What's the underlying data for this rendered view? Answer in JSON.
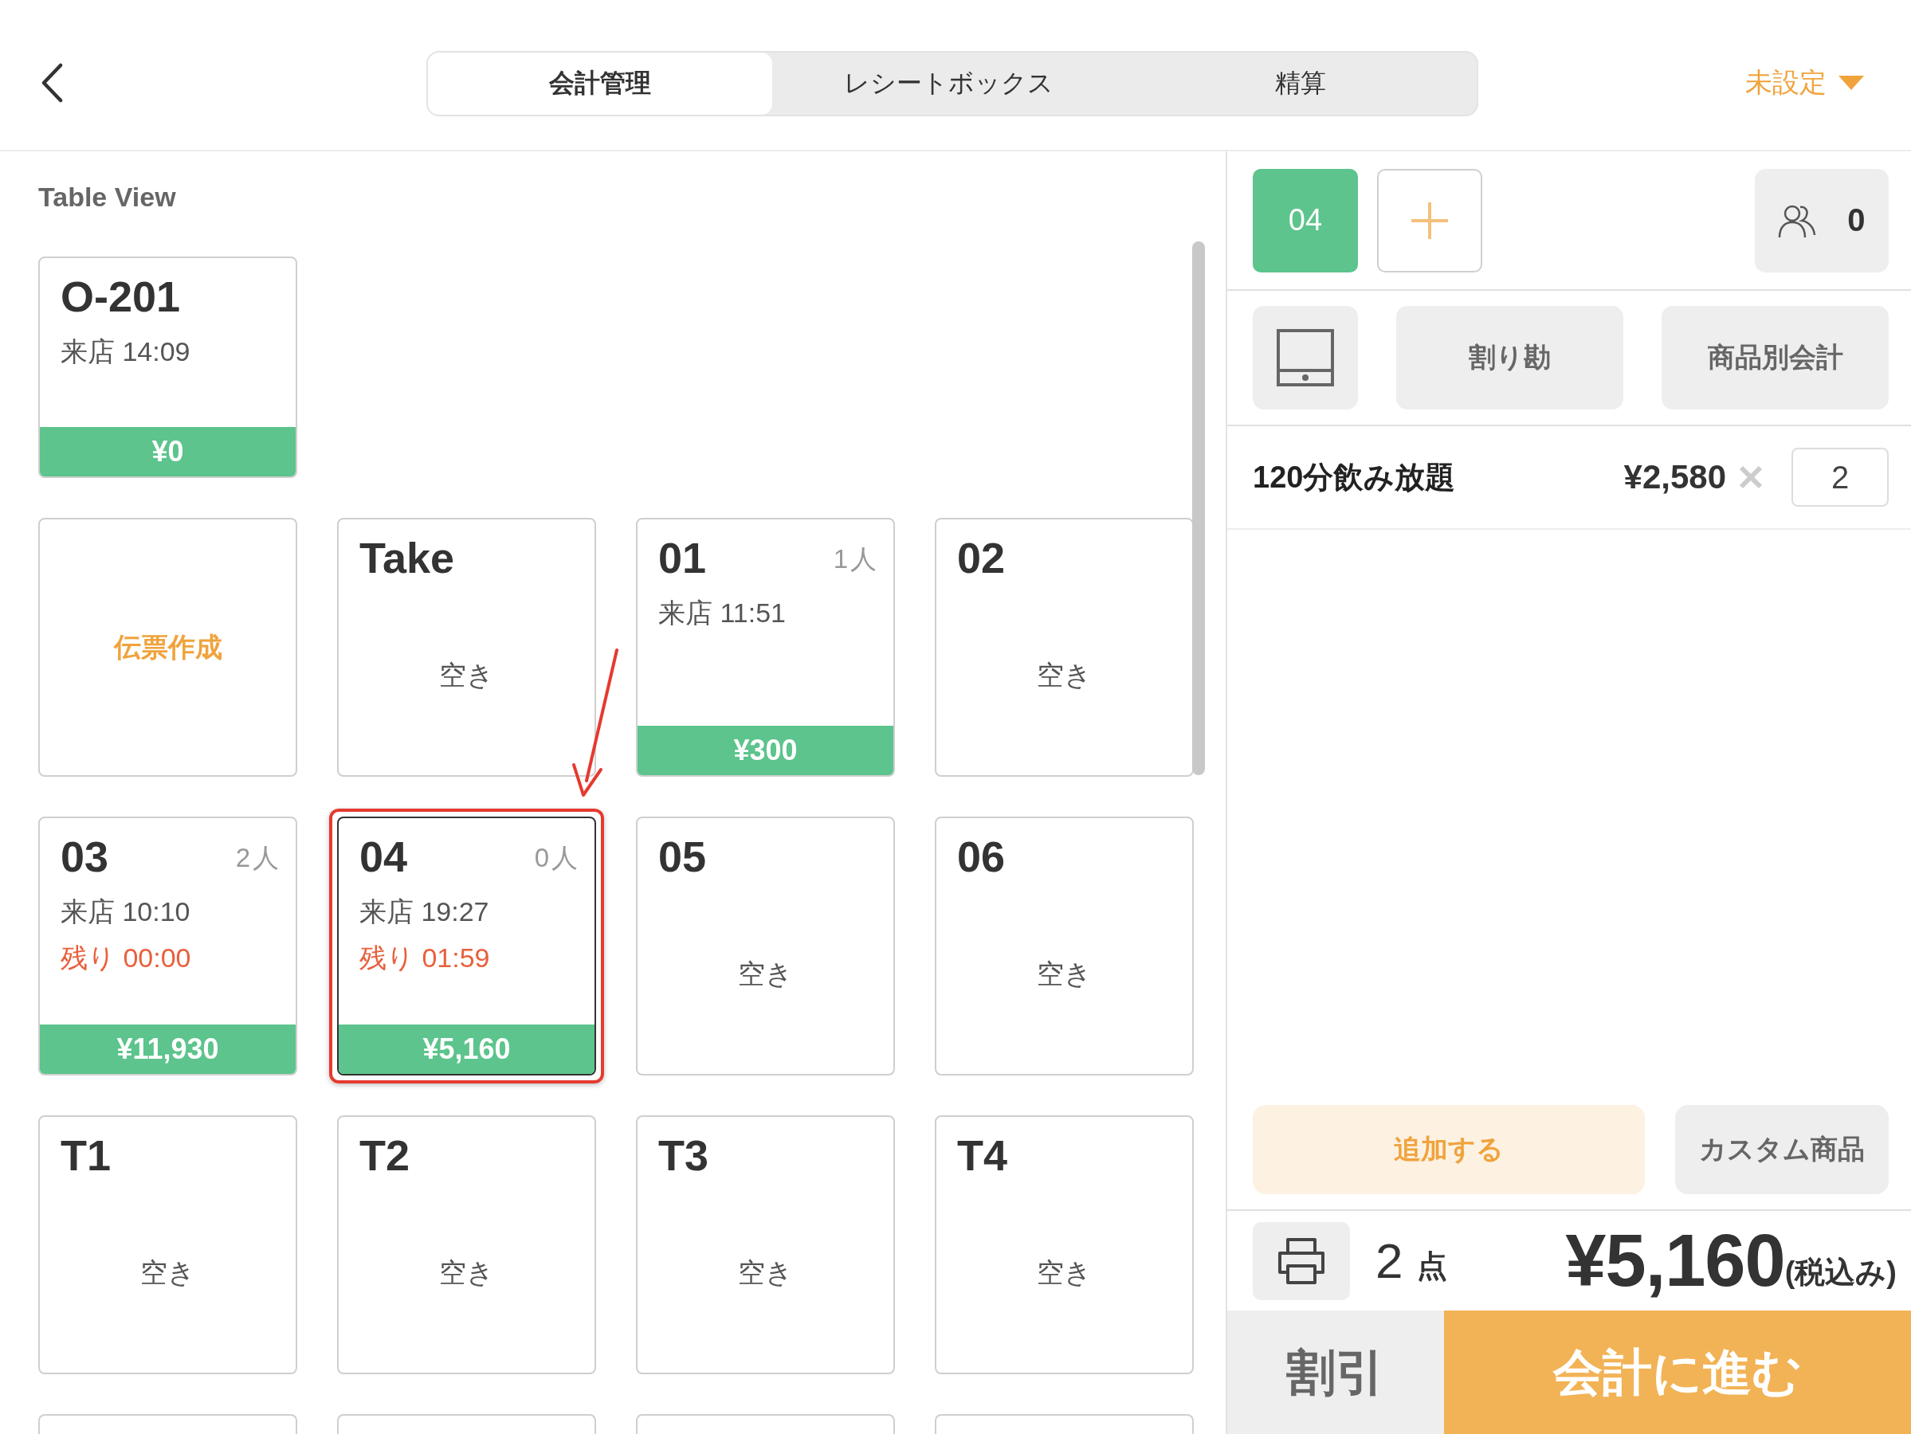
{
  "header": {
    "tabs": [
      {
        "label": "会計管理",
        "selected": true
      },
      {
        "label": "レシートボックス",
        "selected": false
      },
      {
        "label": "精算",
        "selected": false
      }
    ],
    "filter": {
      "label": "未設定"
    }
  },
  "table_view": {
    "title": "Table View",
    "rows": [
      [
        {
          "kind": "table",
          "name": "O-201",
          "arrival": "来店 14:09",
          "amount": "¥0",
          "selected": false
        }
      ],
      [
        {
          "kind": "ticket",
          "label": "伝票作成"
        },
        {
          "kind": "table",
          "name": "Take",
          "status": "空き",
          "selected": false
        },
        {
          "kind": "table",
          "name": "01",
          "guests": "1人",
          "arrival": "来店 11:51",
          "amount": "¥300",
          "selected": false
        },
        {
          "kind": "table",
          "name": "02",
          "status": "空き",
          "selected": false
        }
      ],
      [
        {
          "kind": "table",
          "name": "03",
          "guests": "2人",
          "arrival": "来店 10:10",
          "remaining": "残り 00:00",
          "amount": "¥11,930",
          "selected": false
        },
        {
          "kind": "table",
          "name": "04",
          "guests": "0人",
          "arrival": "来店 19:27",
          "remaining": "残り 01:59",
          "amount": "¥5,160",
          "selected": true
        },
        {
          "kind": "table",
          "name": "05",
          "status": "空き",
          "selected": false
        },
        {
          "kind": "table",
          "name": "06",
          "status": "空き",
          "selected": false
        }
      ],
      [
        {
          "kind": "table",
          "name": "T1",
          "status": "空き",
          "selected": false
        },
        {
          "kind": "table",
          "name": "T2",
          "status": "空き",
          "selected": false
        },
        {
          "kind": "table",
          "name": "T3",
          "status": "空き",
          "selected": false
        },
        {
          "kind": "table",
          "name": "T4",
          "status": "空き",
          "selected": false
        }
      ],
      [
        {
          "kind": "cut"
        },
        {
          "kind": "cut"
        },
        {
          "kind": "cut"
        },
        {
          "kind": "cut"
        }
      ]
    ]
  },
  "order": {
    "table_tabs": [
      {
        "label": "04",
        "selected": true
      }
    ],
    "guests": "0",
    "actions": [
      "割り勘",
      "商品別会計"
    ],
    "items": [
      {
        "name": "120分飲み放題",
        "price": "¥2,580",
        "quantity": "2"
      }
    ],
    "add_button": "追加する",
    "custom_button": "カスタム商品",
    "count": "2",
    "count_unit": "点",
    "total": "¥5,160",
    "tax_note": "(税込み)",
    "discount_button": "割引",
    "checkout_button": "会計に進む"
  }
}
